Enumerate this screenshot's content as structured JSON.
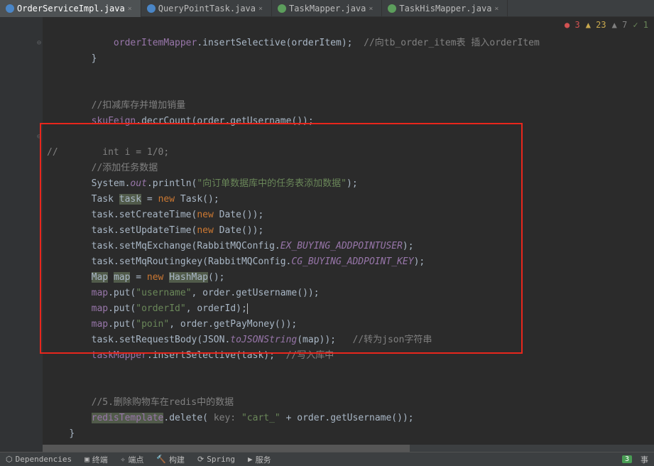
{
  "tabs": [
    {
      "label": "OrderServiceImpl.java",
      "active": true,
      "iconClass": "java-c"
    },
    {
      "label": "QueryPointTask.java",
      "active": false,
      "iconClass": "java-c"
    },
    {
      "label": "TaskMapper.java",
      "active": false,
      "iconClass": "java-i"
    },
    {
      "label": "TaskHisMapper.java",
      "active": false,
      "iconClass": "java-i"
    }
  ],
  "badges": {
    "errors": "3",
    "warnings": "23",
    "weak": "7",
    "ok": "1"
  },
  "code": {
    "l1_a": "orderItemMapper",
    "l1_b": ".insertSelective(orderItem);  ",
    "l1_c": "//向tb_order_item表 插入orderItem",
    "l2": "}",
    "l5": "//扣减库存并增加销量",
    "l6_a": "skuFeign",
    "l6_b": ".decrCount(order.getUsername());",
    "l8_a": "//",
    "l8_b": "        int i = 1/0;",
    "l9": "//添加任务数据",
    "l10_a": "System.",
    "l10_b": "out",
    "l10_c": ".println(",
    "l10_d": "\"向订单数据库中的任务表添加数据\"",
    "l10_e": ");",
    "l11_a": "Task ",
    "l11_b": "task",
    "l11_c": " = ",
    "l11_d": "new",
    "l11_e": " Task();",
    "l12_a": "task.setCreateTime(",
    "l12_b": "new",
    "l12_c": " Date());",
    "l13_a": "task.setUpdateTime(",
    "l13_b": "new",
    "l13_c": " Date());",
    "l14_a": "task.setMqExchange(RabbitMQConfig.",
    "l14_b": "EX_BUYING_ADDPOINTUSER",
    "l14_c": ");",
    "l15_a": "task.setMqRoutingkey(RabbitMQConfig.",
    "l15_b": "CG_BUYING_ADDPOINT_KEY",
    "l15_c": ");",
    "l16_a": "Map",
    "l16_b": " ",
    "l16_c": "map",
    "l16_d": " = ",
    "l16_e": "new",
    "l16_f": " ",
    "l16_g": "HashMap",
    "l16_h": "();",
    "l17_a": "map",
    "l17_b": ".put(",
    "l17_c": "\"username\"",
    "l17_d": ", order.getUsername());",
    "l18_a": "map",
    "l18_b": ".put(",
    "l18_c": "\"orderId\"",
    "l18_d": ", orderId);",
    "l19_a": "map",
    "l19_b": ".put(",
    "l19_c": "\"poin\"",
    "l19_d": ", order.getPayMoney());",
    "l20_a": "task.setRequestBody(JSON.",
    "l20_b": "toJSONString",
    "l20_c": "(map));   ",
    "l20_d": "//转为json字符串",
    "l21_a": "taskMapper",
    "l21_b": ".insertSelective(task);  ",
    "l21_c": "//写入库中",
    "l24_a": "//5.删除购物车在redis中的数据",
    "l25_a": "redisTemplate",
    "l25_b": ".delete(",
    "l25_c": " key: ",
    "l25_d": "\"cart_\"",
    "l25_e": " + order.getUsername());",
    "l26": "}"
  },
  "statusbar": {
    "deps": "Dependencies",
    "terminal": "终端",
    "endpoints": "端点",
    "build": "构建",
    "spring": "Spring",
    "services": "服务",
    "right_count": "3",
    "right_label": "事"
  }
}
